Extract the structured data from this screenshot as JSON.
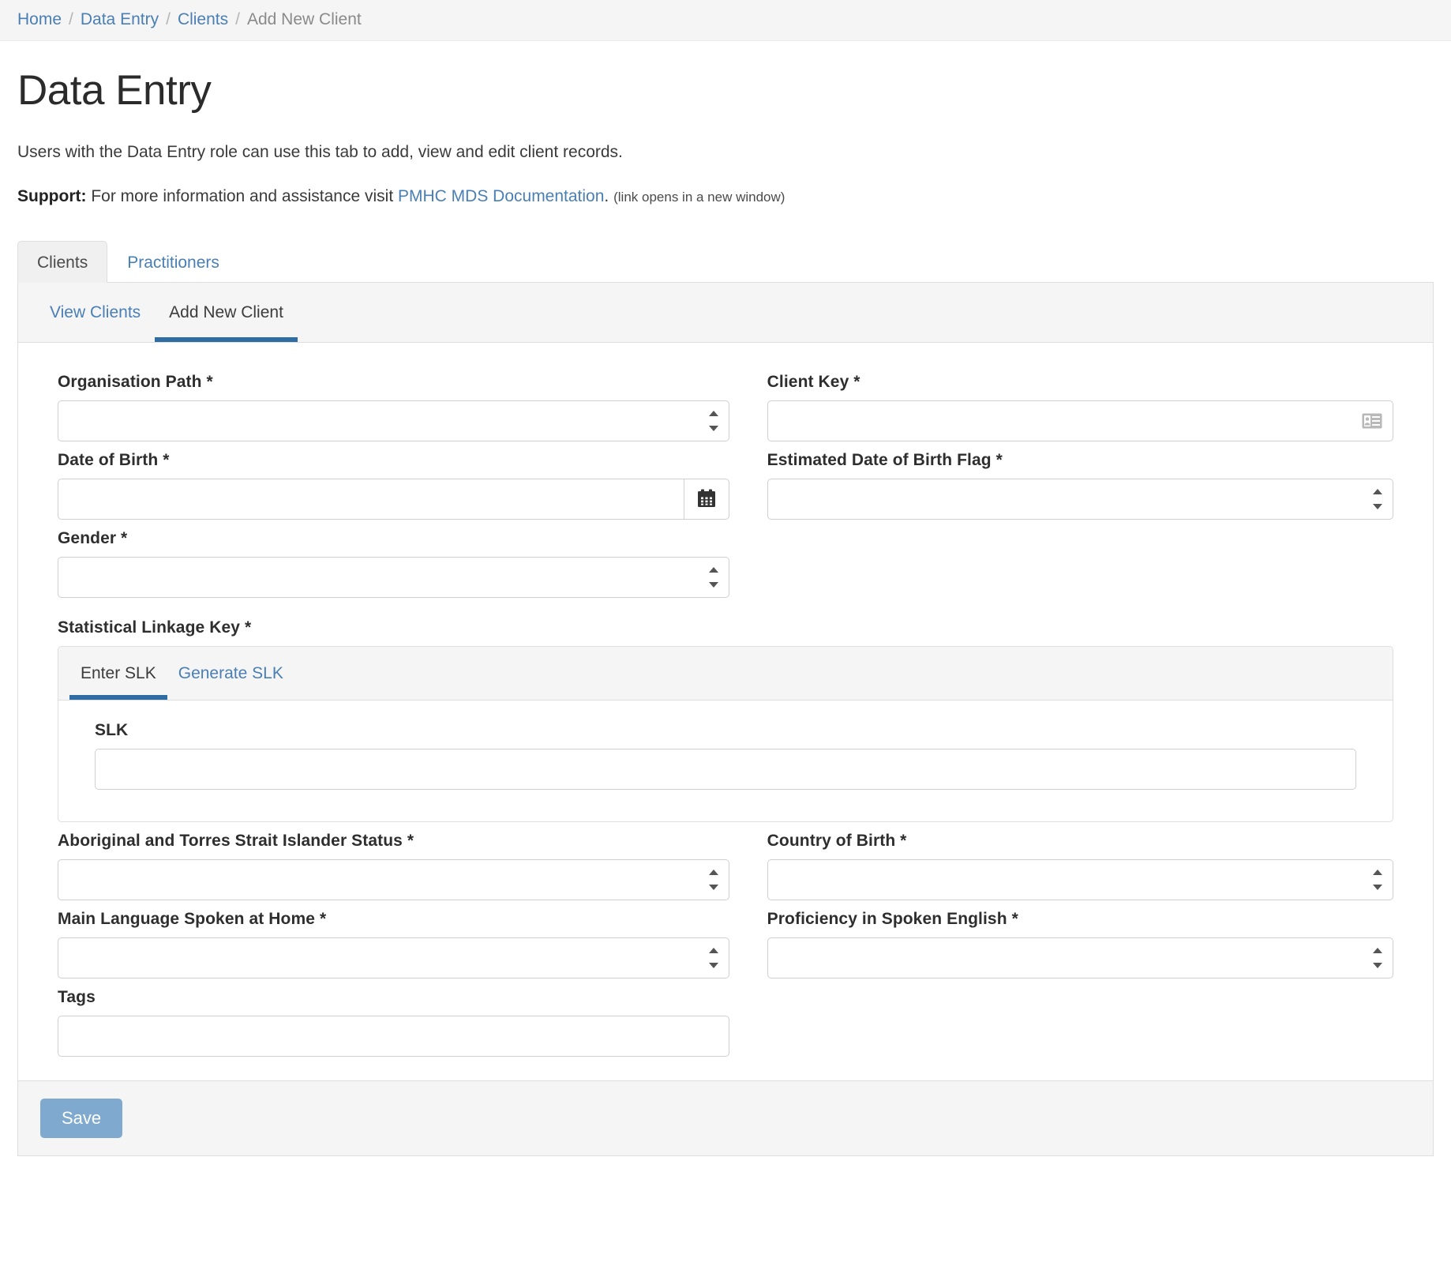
{
  "breadcrumb": {
    "items": [
      {
        "label": "Home",
        "current": false
      },
      {
        "label": "Data Entry",
        "current": false
      },
      {
        "label": "Clients",
        "current": false
      },
      {
        "label": "Add New Client",
        "current": true
      }
    ],
    "separator": "/"
  },
  "page": {
    "title": "Data Entry",
    "description": "Users with the Data Entry role can use this tab to add, view and edit client records.",
    "support_label": "Support:",
    "support_text_before": "For more information and assistance visit",
    "support_link": "PMHC MDS Documentation",
    "support_period": ".",
    "support_note": "(link opens in a new window)"
  },
  "tabs": {
    "outer": [
      {
        "label": "Clients",
        "active": true
      },
      {
        "label": "Practitioners",
        "active": false
      }
    ],
    "inner": [
      {
        "label": "View Clients",
        "active": false
      },
      {
        "label": "Add New Client",
        "active": true
      }
    ]
  },
  "form": {
    "organisation_path": {
      "label": "Organisation Path *",
      "value": "",
      "type": "select"
    },
    "client_key": {
      "label": "Client Key *",
      "value": "",
      "type": "text",
      "icon": "id-card-icon"
    },
    "date_of_birth": {
      "label": "Date of Birth *",
      "value": "",
      "type": "text",
      "icon": "calendar-icon"
    },
    "estimated_dob_flag": {
      "label": "Estimated Date of Birth Flag *",
      "value": "",
      "type": "select"
    },
    "gender": {
      "label": "Gender *",
      "value": "",
      "type": "select"
    },
    "statistical_linkage_key": {
      "label": "Statistical Linkage Key *"
    },
    "slk_tabs": [
      {
        "label": "Enter SLK",
        "active": true
      },
      {
        "label": "Generate SLK",
        "active": false
      }
    ],
    "slk": {
      "label": "SLK",
      "value": "",
      "type": "text"
    },
    "atsi_status": {
      "label": "Aboriginal and Torres Strait Islander Status *",
      "value": "",
      "type": "select"
    },
    "country_of_birth": {
      "label": "Country of Birth *",
      "value": "",
      "type": "select"
    },
    "main_language": {
      "label": "Main Language Spoken at Home *",
      "value": "",
      "type": "select"
    },
    "proficiency_english": {
      "label": "Proficiency in Spoken English *",
      "value": "",
      "type": "select"
    },
    "tags": {
      "label": "Tags",
      "value": "",
      "type": "text"
    }
  },
  "footer": {
    "save_label": "Save"
  },
  "colors": {
    "link": "#4a7fb5",
    "accent": "#2e6da4",
    "save_button": "#7fa9ce",
    "panel_border": "#dedede",
    "subtab_bg": "#f5f5f5"
  }
}
